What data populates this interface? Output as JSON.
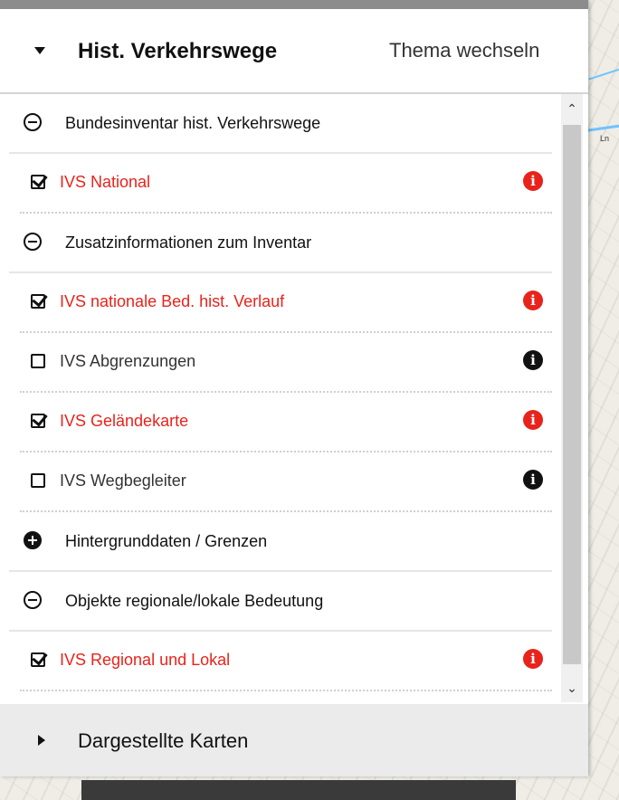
{
  "header": {
    "title": "Hist. Verkehrswege",
    "switch_label": "Thema wechseln"
  },
  "map": {
    "label": "Ln"
  },
  "groups": [
    {
      "label": "Bundesinventar hist. Verkehrswege",
      "expanded": true,
      "layers": [
        {
          "label": "IVS National",
          "checked": true
        }
      ]
    },
    {
      "label": "Zusatzinformationen zum Inventar",
      "expanded": true,
      "layers": [
        {
          "label": "IVS nationale Bed. hist. Verlauf",
          "checked": true
        },
        {
          "label": "IVS Abgrenzungen",
          "checked": false
        },
        {
          "label": "IVS Geländekarte",
          "checked": true
        },
        {
          "label": "IVS Wegbegleiter",
          "checked": false
        }
      ]
    },
    {
      "label": "Hintergrunddaten / Grenzen",
      "expanded": false,
      "layers": []
    },
    {
      "label": "Objekte regionale/lokale Bedeutung",
      "expanded": true,
      "layers": [
        {
          "label": "IVS Regional und Lokal",
          "checked": true
        }
      ]
    }
  ],
  "footer": {
    "label": "Dargestellte Karten"
  },
  "colors": {
    "active": "#e8231c",
    "inactive": "#333333"
  }
}
